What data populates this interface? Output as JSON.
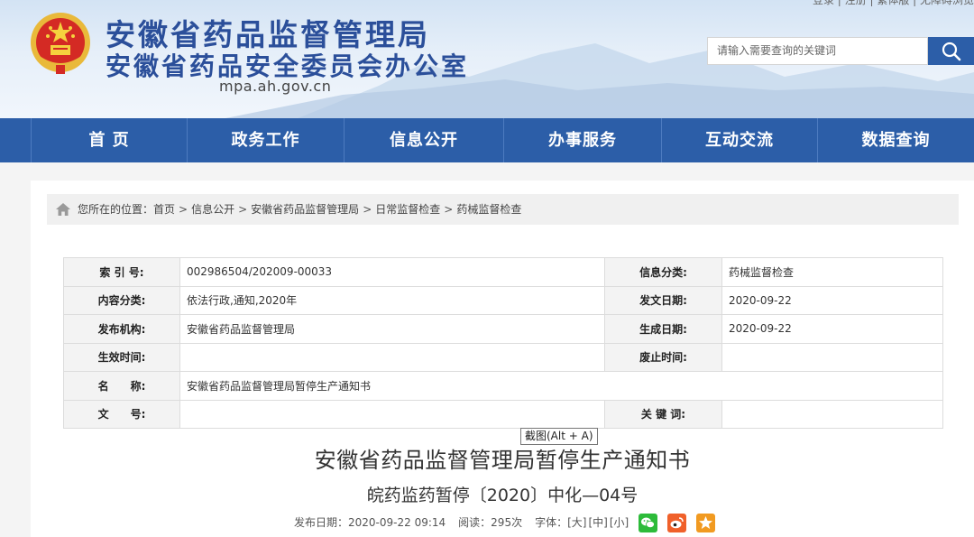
{
  "header": {
    "title_line1": "安徽省药品监督管理局",
    "title_line2": "安徽省药品安全委员会办公室",
    "domain": "mpa.ah.gov.cn",
    "top_links": "登录 | 注册 | 繁体版 | 无障碍浏览",
    "search_placeholder": "请输入需要查询的关键词"
  },
  "nav": {
    "items": [
      {
        "label": "首 页"
      },
      {
        "label": "政务工作"
      },
      {
        "label": "信息公开"
      },
      {
        "label": "办事服务"
      },
      {
        "label": "互动交流"
      },
      {
        "label": "数据查询"
      }
    ]
  },
  "breadcrumb": {
    "prefix": "您所在的位置：",
    "items": [
      "首页",
      "信息公开",
      "安徽省药品监督管理局",
      "日常监督检查",
      "药械监督检查"
    ],
    "separator": ">"
  },
  "meta": {
    "index_label": "索 引 号:",
    "index_value": "002986504/202009-00033",
    "category_label": "信息分类:",
    "category_value": "药械监督检查",
    "content_label": "内容分类:",
    "content_value": "依法行政,通知,2020年",
    "issue_date_label": "发文日期:",
    "issue_date_value": "2020-09-22",
    "publisher_label": "发布机构:",
    "publisher_value": "安徽省药品监督管理局",
    "generate_date_label": "生成日期:",
    "generate_date_value": "2020-09-22",
    "effective_label": "生效时间:",
    "effective_value": "",
    "abolish_label": "废止时间:",
    "abolish_value": "",
    "name_label": "名　　称:",
    "name_value": "安徽省药品监督管理局暂停生产通知书",
    "docno_label": "文　　号:",
    "docno_value": "",
    "keywords_label": "关 键 词:",
    "keywords_value": ""
  },
  "tooltip": "截图(Alt + A)",
  "document": {
    "title": "安徽省药品监督管理局暂停生产通知书",
    "number": "皖药监药暂停〔2020〕中化—04号",
    "publish_label": "发布日期：",
    "publish_time": "2020-09-22 09:14",
    "reads_label": "阅读：",
    "reads": "295次",
    "font_label": "字体：",
    "font_large": "[大]",
    "font_medium": "[中]",
    "font_small": "[小]"
  },
  "share_icons": [
    "wechat-icon",
    "weibo-icon",
    "favorite-icon"
  ],
  "colors": {
    "brand_blue": "#2c5ea8",
    "title_blue": "#2b4f9a",
    "wechat": "#2dbb3a",
    "weibo": "#f0602a",
    "favorite": "#f19a21"
  }
}
